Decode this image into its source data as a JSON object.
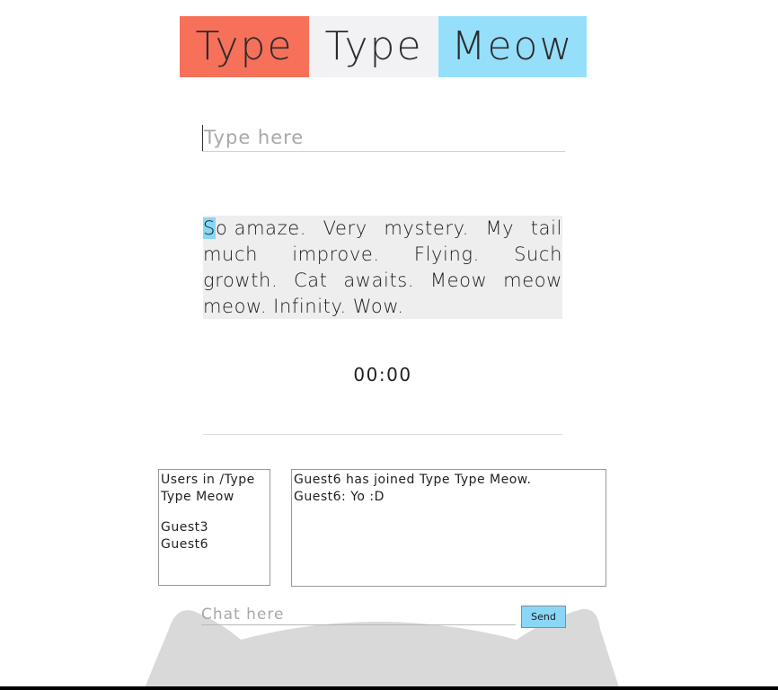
{
  "colors": {
    "logo_word1_bg": "#f7705a",
    "logo_word2_bg": "#f2f2f4",
    "logo_word3_bg": "#96dffa",
    "current_letter_highlight": "#89d6f5",
    "passage_bg": "#eeeeee",
    "send_button_bg": "#89d6f5",
    "cat_silhouette": "#d9d9d9"
  },
  "logo": {
    "word1": "Type",
    "word2": "Type",
    "word3": "Meow"
  },
  "typing": {
    "placeholder": "Type here",
    "value": ""
  },
  "passage": {
    "current_letter": "S",
    "line1": [
      "o amaze.",
      "Very",
      "mystery.",
      "My",
      "tail"
    ],
    "line2": [
      "much",
      "improve.",
      "Flying.",
      "Such"
    ],
    "line3": [
      "growth.",
      "Cat",
      "awaits.",
      "Meow",
      "meow"
    ],
    "line4": [
      "meow.",
      "Infinity.",
      "Wow."
    ]
  },
  "timer": {
    "value": "00:00"
  },
  "users": {
    "title": "Users in /Type Type Meow",
    "list": [
      "Guest3",
      "Guest6"
    ]
  },
  "chat": {
    "messages": [
      "Guest6 has joined Type Type Meow.",
      "Guest6: Yo :D"
    ],
    "input_placeholder": "Chat here",
    "send_label": "Send"
  }
}
